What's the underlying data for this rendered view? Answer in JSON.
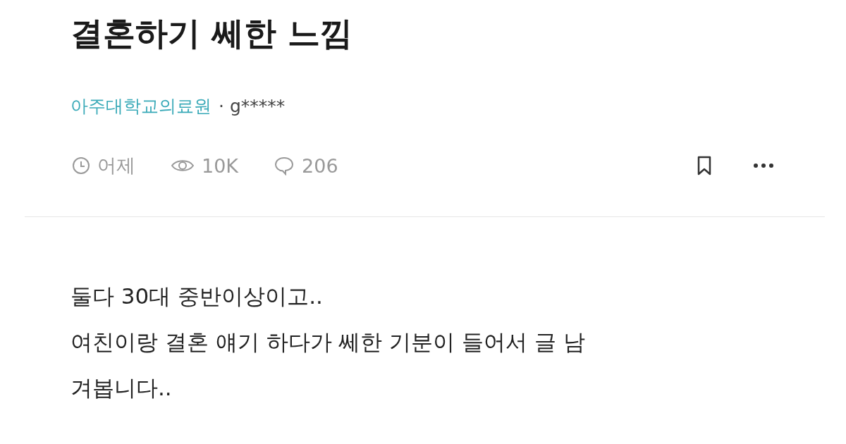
{
  "post": {
    "title": "결혼하기 쎄한 느낌",
    "company": "아주대학교의료원",
    "author": "· g*****",
    "stats": [
      {
        "kind": "time",
        "text": "어제"
      },
      {
        "kind": "views",
        "text": "10K"
      },
      {
        "kind": "comments",
        "text": "206"
      }
    ],
    "body_lines": [
      "둘다 30대 중반이상이고..",
      "여친이랑 결혼 얘기 하다가 쎄한 기분이 들어서 글 남",
      "겨봅니다.."
    ]
  }
}
